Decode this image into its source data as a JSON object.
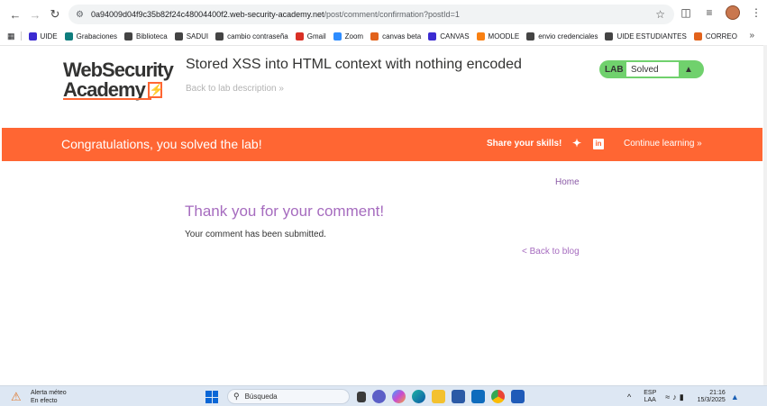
{
  "browser": {
    "url_host": "0a94009d04f9c35b82f24c48004400f2.web-security-academy.net",
    "url_path": "/post/comment/confirmation?postId=1",
    "bookmarks": [
      {
        "label": "UIDE",
        "color": "#3b2bd1"
      },
      {
        "label": "Grabaciones",
        "color": "#0f7d7d"
      },
      {
        "label": "Biblioteca",
        "color": "#444444"
      },
      {
        "label": "SADUI",
        "color": "#444444"
      },
      {
        "label": "cambio contraseña",
        "color": "#444444"
      },
      {
        "label": "Gmail",
        "color": "#d93025"
      },
      {
        "label": "Zoom",
        "color": "#2d8cff"
      },
      {
        "label": "canvas beta",
        "color": "#e2621b"
      },
      {
        "label": "CANVAS",
        "color": "#3b2bd1"
      },
      {
        "label": "MOODLE",
        "color": "#f98012"
      },
      {
        "label": "envio credenciales",
        "color": "#444444"
      },
      {
        "label": "UIDE ESTUDIANTES",
        "color": "#444444"
      },
      {
        "label": "CORREO",
        "color": "#e2621b"
      }
    ]
  },
  "header": {
    "logo_line1": "WebSecurity",
    "logo_line2": "Academy",
    "lab_title": "Stored XSS into HTML context with nothing encoded",
    "back_to_description": "Back to lab description »",
    "lab_badge": "LAB",
    "lab_status": "Solved"
  },
  "banner": {
    "message": "Congratulations, you solved the lab!",
    "share": "Share your skills!",
    "continue": "Continue learning »"
  },
  "content": {
    "home": "Home",
    "heading": "Thank you for your comment!",
    "submitted": "Your comment has been submitted.",
    "back_to_blog": "< Back to blog"
  },
  "taskbar": {
    "weather_title": "Alerta méteo",
    "weather_sub": "En efecto",
    "search_placeholder": "Búsqueda",
    "lang_1": "ESP",
    "lang_2": "LAA",
    "time": "21:16",
    "date": "15/3/2025"
  },
  "colors": {
    "brand_orange": "#ff6633",
    "solved_green": "#70d16d",
    "link_purple": "#a66cbf"
  }
}
